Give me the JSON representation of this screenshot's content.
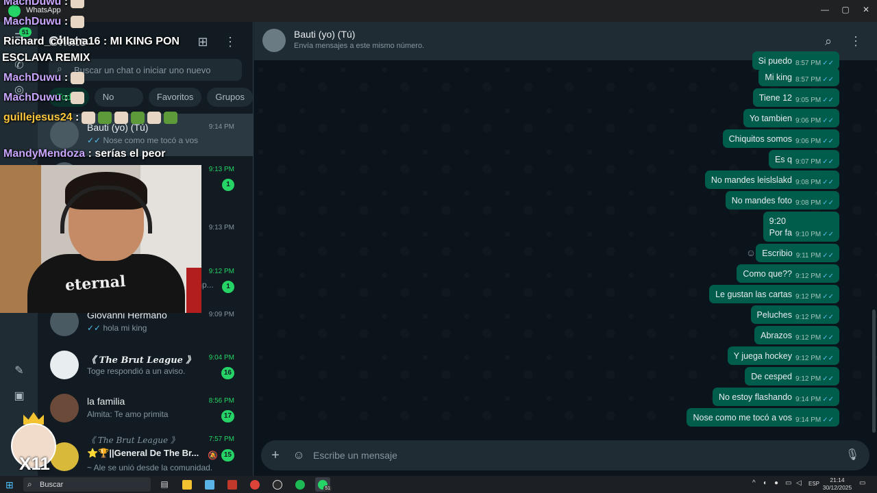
{
  "window": {
    "title": "WhatsApp",
    "controls": [
      "—",
      "▢",
      "✕"
    ]
  },
  "rail": {
    "badge": "51"
  },
  "list": {
    "title": "Chats",
    "search_placeholder": "Buscar un chat o iniciar uno nuevo",
    "filters": [
      "Todos",
      "No leídos",
      "Favoritos",
      "Grupos"
    ],
    "chats": [
      {
        "name": "Bauti (yo) (Tú)",
        "preview": "Nose como me tocó a vos",
        "time": "9:14 PM",
        "ticks": true,
        "unread": "",
        "selected": true
      },
      {
        "name": "",
        "preview": "",
        "time": "9:13 PM",
        "ticks": false,
        "unread": "1",
        "time_unread": true
      },
      {
        "name": "",
        "preview": "",
        "time": "9:13 PM",
        "ticks": false,
        "unread": ""
      },
      {
        "name": "",
        "preview": "mp...",
        "time": "9:12 PM",
        "ticks": false,
        "unread": "1",
        "time_unread": true
      },
      {
        "name": "Giovanni Hermano",
        "preview": "hola mi king",
        "time": "9:09 PM",
        "ticks": true,
        "unread": ""
      },
      {
        "name": "《 The Brut League 》",
        "preview": "Toge respondió a un aviso.",
        "time": "9:04 PM",
        "ticks": false,
        "unread": "16",
        "time_unread": true
      },
      {
        "name": "la familia",
        "preview": "Almita: Te amo primita",
        "time": "8:56 PM",
        "ticks": false,
        "unread": "17",
        "time_unread": true
      },
      {
        "name": "⭐🏆||General De The Br...",
        "preview": "~ Ale se unió desde la comunidad.",
        "time": "7:57 PM",
        "ticks": false,
        "unread": "15",
        "time_unread": true,
        "muted": true,
        "group_header": "《 The Brut League 》"
      }
    ]
  },
  "conversation": {
    "name": "Bauti (yo) (Tú)",
    "subtitle": "Envía mensajes a este mismo número.",
    "composer_placeholder": "Escribe un mensaje",
    "messages": [
      {
        "text": "Si puedo",
        "time": "8:57 PM"
      },
      {
        "text": "Mi king",
        "time": "8:57 PM"
      },
      {
        "text": "Tiene 12",
        "time": "9:05 PM"
      },
      {
        "text": "Yo tambien",
        "time": "9:06 PM"
      },
      {
        "text": "Chiquitos somos",
        "time": "9:06 PM"
      },
      {
        "text": "Es q",
        "time": "9:07 PM"
      },
      {
        "text": "No mandes leislslakd",
        "time": "9:08 PM"
      },
      {
        "text": "No mandes foto",
        "time": "9:08 PM"
      },
      {
        "lines": [
          "9:20",
          "Por fa"
        ],
        "time": "9:10 PM"
      },
      {
        "text": "Escribio",
        "time": "9:11 PM",
        "react": true
      },
      {
        "text": "Como que??",
        "time": "9:12 PM"
      },
      {
        "text": "Le gustan las cartas",
        "time": "9:12 PM"
      },
      {
        "text": "Peluches",
        "time": "9:12 PM"
      },
      {
        "text": "Abrazos",
        "time": "9:12 PM"
      },
      {
        "text": "Y juega hockey",
        "time": "9:12 PM"
      },
      {
        "text": "De cesped",
        "time": "9:12 PM"
      },
      {
        "text": "No estoy flashando",
        "time": "9:14 PM"
      },
      {
        "text": "Nose como me tocó a vos",
        "time": "9:14 PM"
      }
    ]
  },
  "overlay": {
    "lines": [
      {
        "user": "MachDuwu",
        "text": " :",
        "emotes": 1
      },
      {
        "user": "MachDuwu",
        "text": " :",
        "emotes": 1
      },
      {
        "user": "Richard_collana16",
        "text": " : MI KING PON",
        "plain": true
      },
      {
        "user": "",
        "text": "ESCLAVA REMIX",
        "plain": true
      },
      {
        "user": "MachDuwu",
        "text": " :",
        "emotes": 1
      },
      {
        "user": "MachDuwu",
        "text": " :",
        "emotes": 1
      },
      {
        "user": "guillejesus24",
        "text": " :",
        "gold": true
      },
      {
        "user": "MandyMendoza",
        "text": " : serías el peor"
      }
    ],
    "webcam_shirt": "eternal",
    "pfp_text": "X11"
  },
  "taskbar": {
    "search_placeholder": "Buscar",
    "whatsapp_badge": "51",
    "lang": "ESP",
    "time": "21:14",
    "date": "30/12/2025"
  },
  "colors": {
    "accent": "#25d366",
    "bubble": "#005c4b",
    "panel": "#202c33",
    "background": "#0b141a"
  }
}
